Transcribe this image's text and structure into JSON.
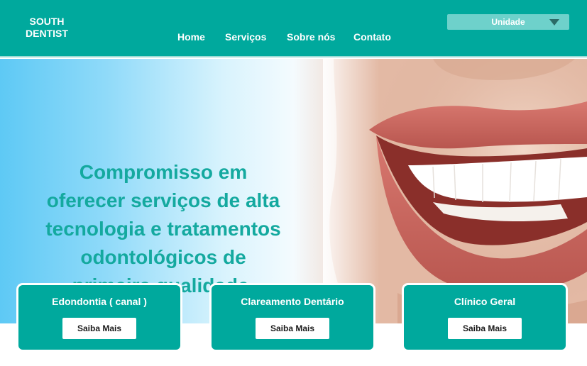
{
  "brand": {
    "line1": "SOUTH",
    "line2": "DENTIST"
  },
  "nav": {
    "items": [
      "Home",
      "Serviços",
      "Sobre nós",
      "Contato"
    ]
  },
  "unit_select": {
    "selected": "Unidade"
  },
  "hero": {
    "headline_lines": [
      "Compromisso em",
      "oferecer serviços de alta",
      "tecnologia e tratamentos",
      "odontológicos de",
      "primeira qualidade."
    ]
  },
  "services": [
    {
      "title": "Edondontia ( canal )",
      "button": "Saiba Mais"
    },
    {
      "title": "Clareamento Dentário",
      "button": "Saiba Mais"
    },
    {
      "title": "Clínico Geral",
      "button": "Saiba Mais"
    }
  ],
  "colors": {
    "primary": "#00a99d",
    "headline": "#14a99f",
    "select_bg": "#6ed1cb",
    "button_bg": "#ffffff"
  }
}
